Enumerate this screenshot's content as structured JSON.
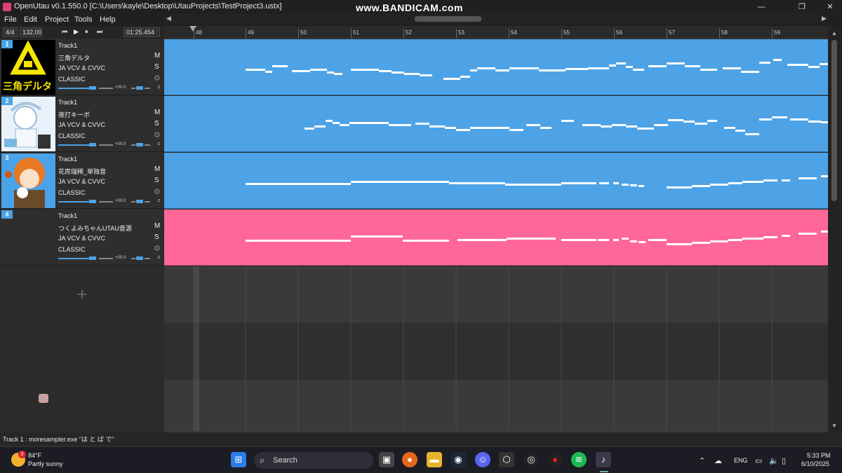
{
  "window": {
    "title": "OpenUtau v0.1.550.0 [C:\\Users\\kayle\\Desktop\\UtauProjects\\TestProject3.ustx]",
    "watermark": "www.BANDICAM.com",
    "controls": {
      "minimize": "—",
      "maximize": "❐",
      "close": "✕"
    }
  },
  "menu": [
    "File",
    "Edit",
    "Project",
    "Tools",
    "Help"
  ],
  "toolbar": {
    "time_signature": "4/4",
    "tempo": "132.00",
    "playback": {
      "first": "⏮",
      "play": "▶",
      "pause": "⏸",
      "last": "⏭"
    },
    "position": "01:25.454"
  },
  "ruler": {
    "bars": [
      "48",
      "49",
      "50",
      "51",
      "52",
      "53",
      "54",
      "55",
      "56",
      "57",
      "58",
      "59"
    ]
  },
  "tracks": [
    {
      "number": "1",
      "name": "Track1",
      "singer": "三角デルタ",
      "phonemizer": "JA VCV & CVVC",
      "renderer": "CLASSIC",
      "mute": "M",
      "solo": "S",
      "volume": "+00.0",
      "pan_flag": "c",
      "avatar_text": "三角デルタ",
      "part_color": "#4ea3e6"
    },
    {
      "number": "2",
      "name": "Track1",
      "singer": "夜打キーボ",
      "phonemizer": "JA VCV & CVVC",
      "renderer": "CLASSIC",
      "mute": "M",
      "solo": "S",
      "volume": "+00.0",
      "pan_flag": "c",
      "avatar_text": "",
      "part_color": "#4ea3e6"
    },
    {
      "number": "3",
      "name": "Track1",
      "singer": "花房瑞稀_単独音",
      "phonemizer": "JA VCV & CVVC",
      "renderer": "CLASSIC",
      "mute": "M",
      "solo": "S",
      "volume": "+00.0",
      "pan_flag": "c",
      "avatar_text": "",
      "part_color": "#4ea3e6"
    },
    {
      "number": "4",
      "name": "Track1",
      "singer": "つくよみちゃんUTAU音源",
      "phonemizer": "JA VCV & CVVC",
      "renderer": "CLASSIC",
      "mute": "M",
      "solo": "S",
      "volume": "+00.0",
      "pan_flag": "c",
      "avatar_text": "",
      "part_color": "#ff6799"
    }
  ],
  "add_track": "+",
  "status": "Track 1 : moresampler.exe \"は と ば で\"",
  "taskbar": {
    "weather": {
      "badge": "3",
      "temp": "84°F",
      "condition": "Partly sunny"
    },
    "search_placeholder": "Search",
    "tray": {
      "up_arrow": "⌃",
      "language": "ENG",
      "time": "5:33 PM",
      "date": "6/10/2025"
    }
  },
  "colors": {
    "accent": "#4aa3e8",
    "part_blue": "#4ea3e6",
    "part_pink": "#ff6799"
  }
}
